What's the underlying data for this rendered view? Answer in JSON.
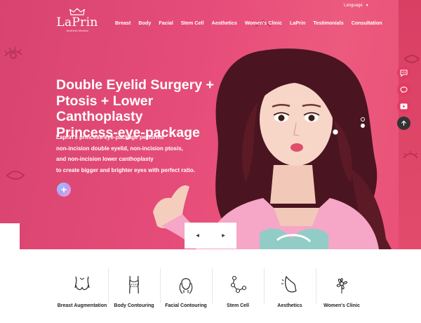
{
  "header": {
    "logo_name": "LaPrin",
    "logo_sub": "Aesthetic Medical",
    "language_label": "Language",
    "nav": [
      "Breast",
      "Body",
      "Facial",
      "Stem Cell",
      "Aesthetics",
      "Women's Clinic",
      "LaPrin",
      "Testimonials",
      "Consultation"
    ]
  },
  "hero": {
    "title_lines": [
      "Double Eyelid Surgery +",
      "Ptosis + Lower Canthoplasty",
      "Princess-eye-package"
    ],
    "desc_lines": [
      "Laprin's princess-eye-package performs",
      "non-incision double eyelid, non-incision ptosis,",
      "and non-incision lower canthoplasty",
      "to create bigger and brighter eyes with perfect ratio."
    ],
    "plus_label": "+",
    "prev_arrow": "◀",
    "next_arrow": "▶"
  },
  "quick_menu": [
    {
      "icon": "chat-icon"
    },
    {
      "icon": "kakao-icon"
    },
    {
      "icon": "youtube-icon"
    },
    {
      "icon": "scroll-top-icon"
    }
  ],
  "categories": [
    {
      "label": "Breast Augmentation",
      "icon": "breast-icon"
    },
    {
      "label": "Body Contouring",
      "icon": "body-icon"
    },
    {
      "label": "Facial Contouring",
      "icon": "face-icon"
    },
    {
      "label": "Stem Cell",
      "icon": "stem-cell-icon"
    },
    {
      "label": "Aesthetics",
      "icon": "aesthetics-icon"
    },
    {
      "label": "Women's Clinic",
      "icon": "flower-icon"
    }
  ],
  "colors": {
    "hero_pink": "#e64c79",
    "accent_red": "#e33a63",
    "text_dark": "#222222"
  }
}
